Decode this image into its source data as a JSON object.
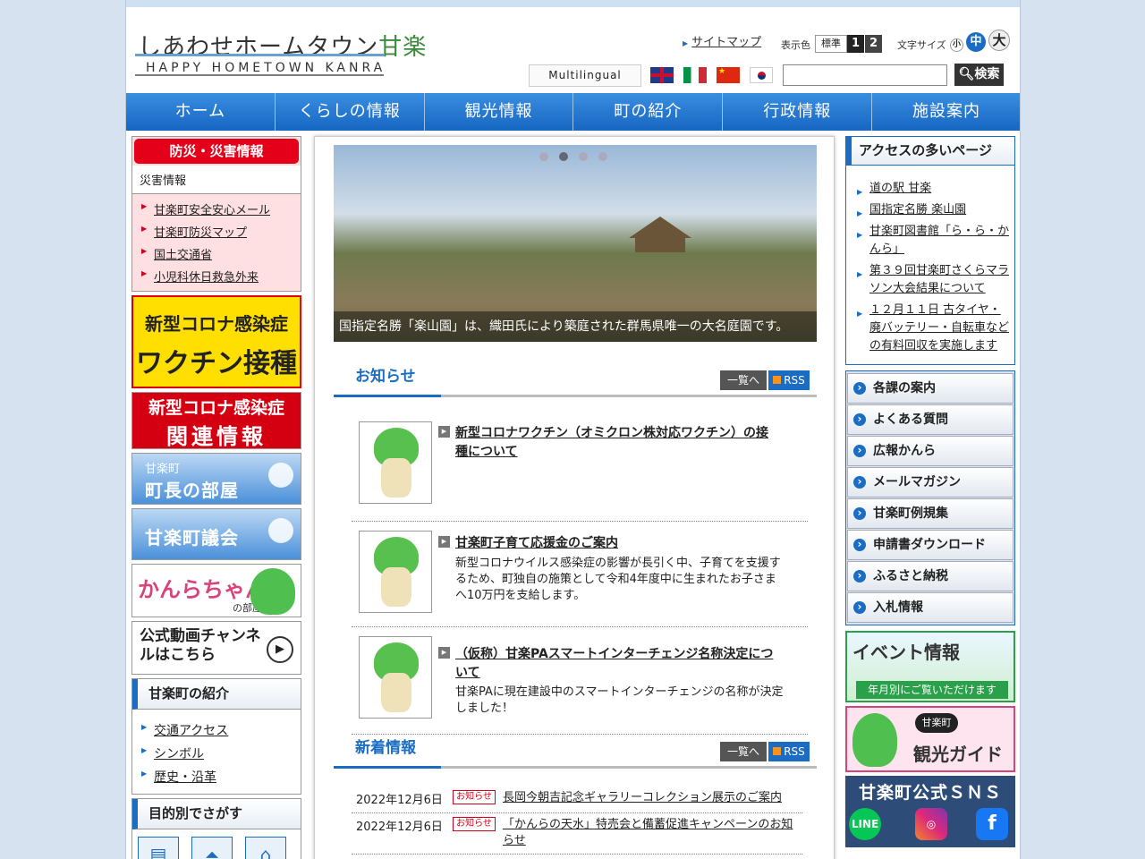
{
  "header": {
    "logo_jp": "しあわせホームタウン",
    "logo_kan": "甘楽",
    "logo_en": "HAPPY HOMETOWN KANRA",
    "sitemap": "サイトマップ",
    "color_label": "表示色",
    "color_std": "標準",
    "color_1": "1",
    "color_2": "2",
    "size_label": "文字サイズ",
    "size_s": "小",
    "size_m": "中",
    "size_l": "大",
    "multilingual": "Multilingual",
    "search_placeholder": "",
    "search_button": "検索"
  },
  "gnav": [
    "ホーム",
    "くらしの情報",
    "観光情報",
    "町の紹介",
    "行政情報",
    "施設案内"
  ],
  "left": {
    "disaster_head": "防災・災害情報",
    "disaster_sub": "災害情報",
    "disaster_links": [
      "甘楽町安全安心メール",
      "甘楽町防災マップ",
      "国土交通省",
      "小児科休日救急外来"
    ],
    "vaccine_l1": "新型コロナ感染症",
    "vaccine_l2": "ワクチン接種",
    "corona_l1": "新型コロナ感染症",
    "corona_l2": "関連情報",
    "mayor_s": "甘楽町",
    "mayor_t": "町長の部屋",
    "council_t": "甘楽町議会",
    "kanra_t": "かんらちゃん",
    "kanra_s": "の部屋",
    "video_t": "公式動画チャンネルはこちら",
    "intro_head": "甘楽町の紹介",
    "intro_links": [
      "交通アクセス",
      "シンボル",
      "歴史・沿革"
    ],
    "purpose_head": "目的別でさがす"
  },
  "main": {
    "slider_caption": "国指定名勝「楽山園」は、織田氏により築庭された群馬県唯一の大名庭園です。",
    "news_title": "お知らせ",
    "list_btn": "一覧へ",
    "rss_btn": "RSS",
    "news_items": [
      {
        "title": "新型コロナワクチン（オミクロン株対応ワクチン）の接種について",
        "desc": ""
      },
      {
        "title": "甘楽町子育て応援金のご案内",
        "desc": "新型コロナウイルス感染症の影響が長引く中、子育てを支援するため、町独自の施策として令和4年度中に生まれたお子さまへ10万円を支給します。"
      },
      {
        "title": "（仮称）甘楽PAスマートインターチェンジ名称決定について",
        "desc": "甘楽PAに現在建設中のスマートインターチェンジの名称が決定しました！"
      }
    ],
    "new_title": "新着情報",
    "new_items": [
      {
        "date": "2022年12月6日",
        "badge": "お知らせ",
        "text": "長岡今朝吉記念ギャラリーコレクション展示のご案内"
      },
      {
        "date": "2022年12月6日",
        "badge": "お知らせ",
        "text": "「かんらの天水」特売会と備蓄促進キャンペーンのお知らせ"
      }
    ]
  },
  "right": {
    "access_head": "アクセスの多いページ",
    "access_links": [
      "道の駅 甘楽",
      "国指定名勝 楽山園",
      "甘楽町図書館「ら・ら・かんら」",
      "第３９回甘楽町さくらマラソン大会結果について",
      "１２月１１日 古タイヤ・廃バッテリー・自転車などの有料回収を実施します"
    ],
    "quick_links": [
      "各課の案内",
      "よくある質問",
      "広報かんら",
      "メールマガジン",
      "甘楽町例規集",
      "申請書ダウンロード",
      "ふるさと納税",
      "入札情報"
    ],
    "event_t": "イベント情報",
    "event_s": "年月別にご覧いただけます",
    "guide_badge": "甘楽町",
    "guide_t": "観光ガイド",
    "sns_t": "甘楽町公式ＳＮＳ"
  }
}
